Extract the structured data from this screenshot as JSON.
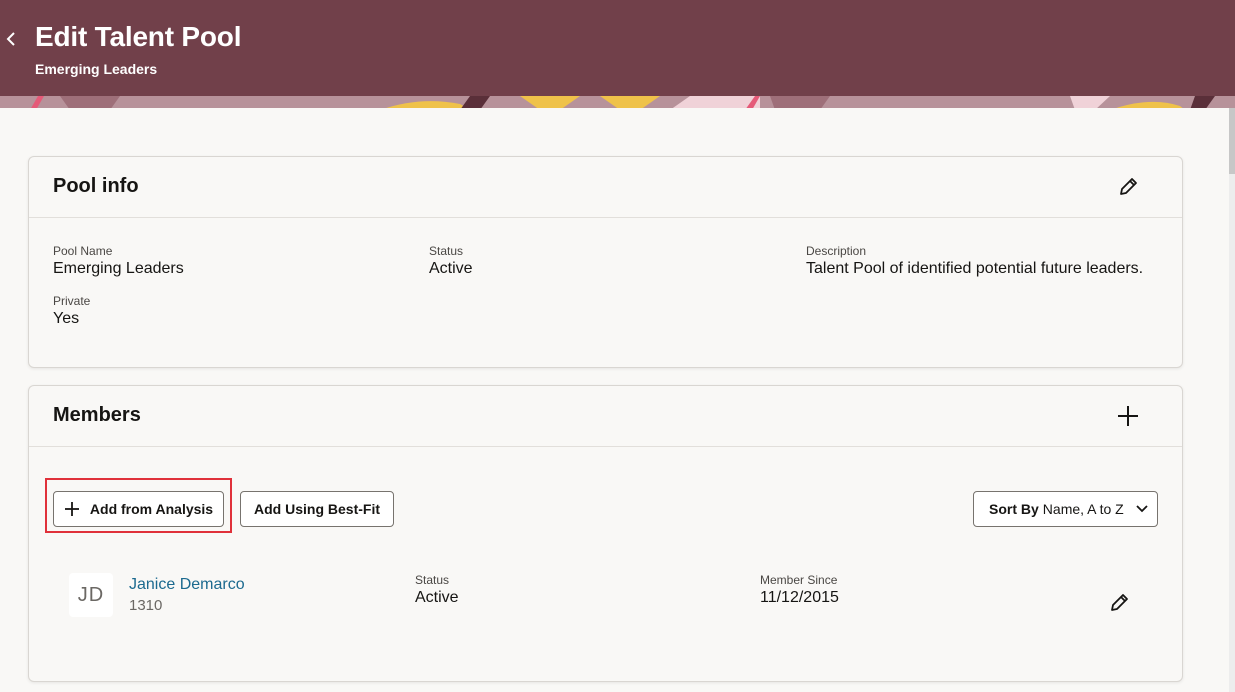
{
  "header": {
    "title": "Edit Talent Pool",
    "subtitle": "Emerging Leaders",
    "back_icon": "chevron-left-icon",
    "color": "#71404a"
  },
  "pool_info": {
    "title": "Pool info",
    "edit_icon": "pencil-icon",
    "fields": {
      "pool_name_label": "Pool Name",
      "pool_name_value": "Emerging Leaders",
      "status_label": "Status",
      "status_value": "Active",
      "description_label": "Description",
      "description_value": "Talent Pool of identified potential future leaders.",
      "private_label": "Private",
      "private_value": "Yes"
    }
  },
  "members": {
    "title": "Members",
    "add_icon": "plus-icon",
    "add_from_analysis_label": "Add from Analysis",
    "add_best_fit_label": "Add Using Best-Fit",
    "sort_by_label": "Sort By",
    "sort_by_value": "Name, A to Z",
    "list": [
      {
        "initials": "JD",
        "name": "Janice Demarco",
        "id": "1310",
        "status_label": "Status",
        "status_value": "Active",
        "member_since_label": "Member Since",
        "member_since_value": "11/12/2015"
      }
    ]
  },
  "colors": {
    "link": "#1c6a8f",
    "highlight": "#e0313a"
  }
}
